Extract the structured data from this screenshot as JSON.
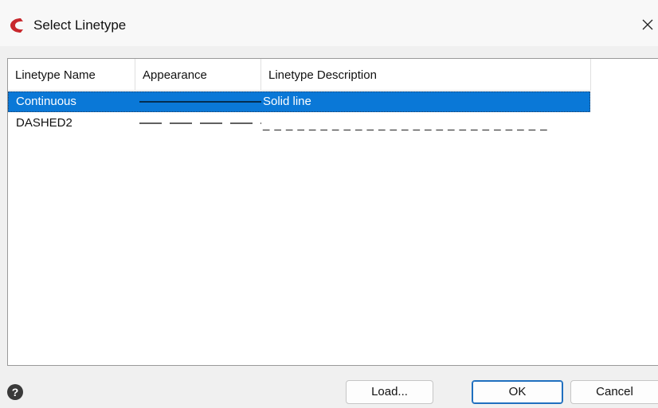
{
  "window": {
    "title": "Select Linetype",
    "app_icon": "app-logo-icon",
    "close_icon": "close-icon"
  },
  "table": {
    "columns": [
      "Linetype Name",
      "Appearance",
      "Linetype Description"
    ],
    "rows": [
      {
        "name": "Continuous",
        "appearance": "solid-line",
        "description": "Solid line",
        "selected": true
      },
      {
        "name": "DASHED2",
        "appearance": "dashed-line",
        "description": "_ _ _ _ _ _ _ _ _ _ _ _ _ _ _ _ _ _ _ _ _ _ _ _ _",
        "selected": false
      }
    ]
  },
  "footer": {
    "help_icon": "help-icon",
    "load_label": "Load...",
    "ok_label": "OK",
    "cancel_label": "Cancel"
  },
  "colors": {
    "selection": "#0a78d7",
    "brand_red": "#c8282d",
    "default_button_border": "#1f6fbf"
  }
}
